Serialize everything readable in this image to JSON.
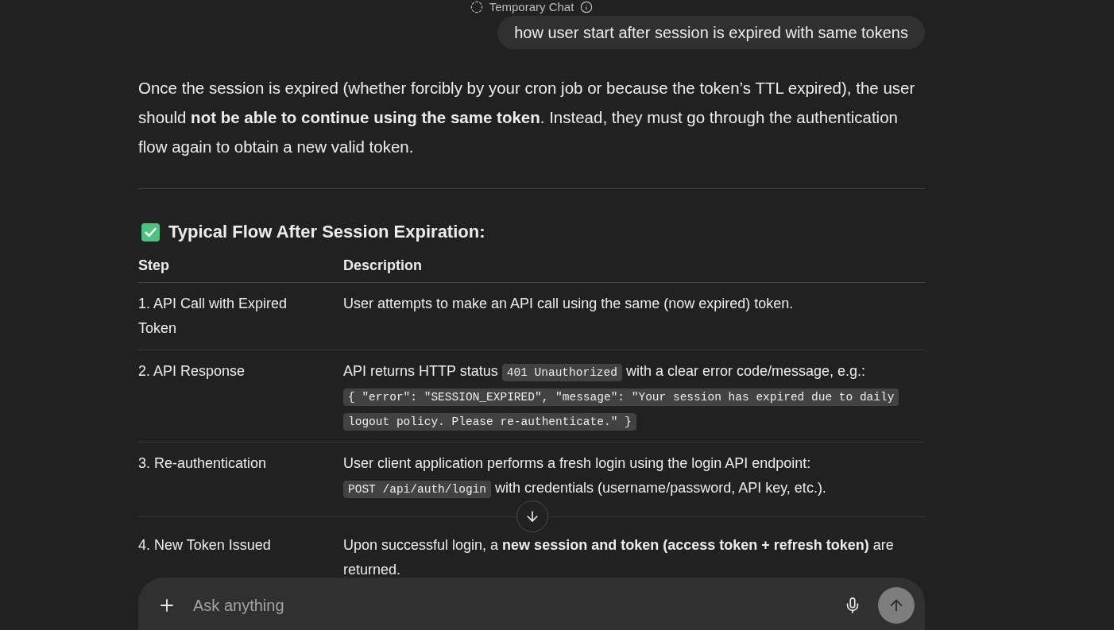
{
  "header": {
    "title": "Temporary Chat"
  },
  "user_message": {
    "text": "how user start after session is expired with same tokens"
  },
  "response": {
    "intro": "Once the session is expired (whether forcibly by your cron job or because the token’s TTL expired), the user should **not be able to continue using the same token**. Instead, they must go through the authentication flow again to obtain a new valid token.",
    "section_heading": "Typical Flow After Session Expiration:",
    "table": {
      "columns": [
        "Step",
        "Description"
      ],
      "rows": [
        {
          "step": "1. API Call with Expired Token",
          "description": [
            [
              {
                "kind": "text",
                "text": "User attempts to make an API call using the same (now expired) token."
              }
            ]
          ]
        },
        {
          "step": "2. API Response",
          "description": [
            [
              {
                "kind": "text",
                "text": "API returns HTTP status "
              },
              {
                "kind": "code",
                "text": "401 Unauthorized"
              },
              {
                "kind": "text",
                "text": " with a clear error code/message, e.g.:"
              }
            ],
            [
              {
                "kind": "code",
                "text": "{ \"error\": \"SESSION_EXPIRED\", \"message\": \"Your session has expired due to daily logout policy. Please re-authenticate.\" }"
              }
            ]
          ]
        },
        {
          "step": "3. Re-authentication",
          "description": [
            [
              {
                "kind": "text",
                "text": "User client application performs a fresh login using the login API endpoint: "
              },
              {
                "kind": "code",
                "text": "POST /api/auth/login"
              },
              {
                "kind": "text",
                "text": " with credentials (username/password, API key, etc.)."
              }
            ]
          ]
        },
        {
          "step": "4. New Token Issued",
          "description": [
            [
              {
                "kind": "text",
                "text": "Upon successful login, a **new session and token (access token + refresh token)** are returned."
              }
            ]
          ]
        }
      ]
    }
  },
  "composer": {
    "placeholder": "Ask anything",
    "send_button": {
      "disabled": true
    }
  }
}
